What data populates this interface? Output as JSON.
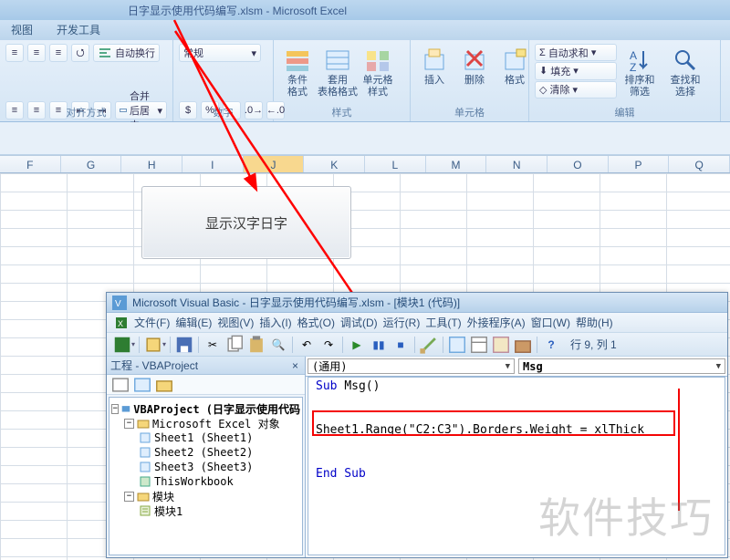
{
  "excel": {
    "title": "日字显示使用代码编写.xlsm - Microsoft Excel",
    "tabs": {
      "view": "视图",
      "dev": "开发工具"
    }
  },
  "ribbon": {
    "wrap": "自动换行",
    "merge": "合并后居中",
    "align_label": "对齐方式",
    "numfmt": "常规",
    "number_label": "数字",
    "cond": "条件格式",
    "tablefmt": "套用\n表格格式",
    "cellstyle": "单元格\n样式",
    "styles_label": "样式",
    "insert": "插入",
    "delete": "删除",
    "format": "格式",
    "cells_label": "单元格",
    "autosum": "自动求和",
    "fill": "填充",
    "clear": "清除",
    "sortfilter": "排序和\n筛选",
    "findselect": "查找和\n选择",
    "edit_label": "编辑"
  },
  "columns": [
    "F",
    "G",
    "H",
    "I",
    "J",
    "K",
    "L",
    "M",
    "N",
    "O",
    "P",
    "Q"
  ],
  "button_text": "显示汉字日字",
  "vba": {
    "title": "Microsoft Visual Basic - 日字显示使用代码编写.xlsm - [模块1 (代码)]",
    "menus": {
      "file": "文件(F)",
      "edit": "编辑(E)",
      "view": "视图(V)",
      "insert": "插入(I)",
      "format": "格式(O)",
      "debug": "调试(D)",
      "run": "运行(R)",
      "tool": "工具(T)",
      "addin": "外接程序(A)",
      "window": "窗口(W)",
      "help": "帮助(H)"
    },
    "cursor": "行 9, 列 1",
    "pane_title": "工程 - VBAProject",
    "proj": "VBAProject (日字显示使用代码",
    "objs": "Microsoft Excel 对象",
    "sheet1": "Sheet1 (Sheet1)",
    "sheet2": "Sheet2 (Sheet2)",
    "sheet3": "Sheet3 (Sheet3)",
    "thiswb": "ThisWorkbook",
    "modfolder": "模块",
    "mod1": "模块1",
    "combo_left": "(通用)",
    "combo_right": "Msg",
    "code": {
      "l1a": "Sub ",
      "l1b": "Msg()",
      "l2": "Sheet1.Range(\"C2:C3\").Borders.Weight = xlThick",
      "l3": "End Sub"
    }
  },
  "watermark": "软件技巧"
}
